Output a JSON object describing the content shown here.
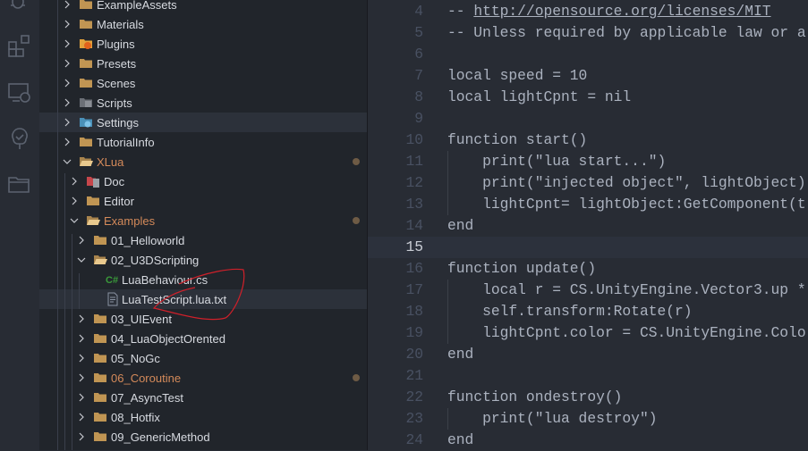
{
  "activity_bar": {
    "icons": [
      "debug-icon",
      "extensions-icon",
      "remote-explorer-icon",
      "source-control-tree-icon",
      "folder-icon"
    ]
  },
  "explorer": {
    "items": [
      {
        "label": "ExampleAssets",
        "depth": 0,
        "type": "folder",
        "expanded": false,
        "icon": "folder-icon"
      },
      {
        "label": "Materials",
        "depth": 0,
        "type": "folder",
        "expanded": false,
        "icon": "folder-icon"
      },
      {
        "label": "Plugins",
        "depth": 0,
        "type": "folder",
        "expanded": false,
        "icon": "plugins-folder-icon"
      },
      {
        "label": "Presets",
        "depth": 0,
        "type": "folder",
        "expanded": false,
        "icon": "folder-icon"
      },
      {
        "label": "Scenes",
        "depth": 0,
        "type": "folder",
        "expanded": false,
        "icon": "folder-icon"
      },
      {
        "label": "Scripts",
        "depth": 0,
        "type": "folder",
        "expanded": false,
        "icon": "scripts-folder-icon"
      },
      {
        "label": "Settings",
        "depth": 0,
        "type": "folder",
        "expanded": false,
        "icon": "settings-folder-icon",
        "hover": true
      },
      {
        "label": "TutorialInfo",
        "depth": 0,
        "type": "folder",
        "expanded": false,
        "icon": "folder-icon"
      },
      {
        "label": "XLua",
        "depth": 0,
        "type": "folder",
        "expanded": true,
        "icon": "folder-open-icon",
        "modified": true
      },
      {
        "label": "Doc",
        "depth": 1,
        "type": "folder",
        "expanded": false,
        "icon": "docs-folder-icon"
      },
      {
        "label": "Editor",
        "depth": 1,
        "type": "folder",
        "expanded": false,
        "icon": "folder-icon"
      },
      {
        "label": "Examples",
        "depth": 1,
        "type": "folder",
        "expanded": true,
        "icon": "folder-open-icon",
        "modified": true
      },
      {
        "label": "01_Helloworld",
        "depth": 2,
        "type": "folder",
        "expanded": false,
        "icon": "folder-icon"
      },
      {
        "label": "02_U3DScripting",
        "depth": 2,
        "type": "folder",
        "expanded": true,
        "icon": "folder-open-icon"
      },
      {
        "label": "LuaBehaviour.cs",
        "depth": 3,
        "type": "file",
        "icon": "csharp-file-icon"
      },
      {
        "label": "LuaTestScript.lua.txt",
        "depth": 3,
        "type": "file",
        "icon": "text-file-icon",
        "selected": true
      },
      {
        "label": "03_UIEvent",
        "depth": 2,
        "type": "folder",
        "expanded": false,
        "icon": "folder-icon"
      },
      {
        "label": "04_LuaObjectOrented",
        "depth": 2,
        "type": "folder",
        "expanded": false,
        "icon": "folder-icon"
      },
      {
        "label": "05_NoGc",
        "depth": 2,
        "type": "folder",
        "expanded": false,
        "icon": "folder-icon"
      },
      {
        "label": "06_Coroutine",
        "depth": 2,
        "type": "folder",
        "expanded": false,
        "icon": "folder-icon",
        "modified": true
      },
      {
        "label": "07_AsyncTest",
        "depth": 2,
        "type": "folder",
        "expanded": false,
        "icon": "folder-icon"
      },
      {
        "label": "08_Hotfix",
        "depth": 2,
        "type": "folder",
        "expanded": false,
        "icon": "folder-icon"
      },
      {
        "label": "09_GenericMethod",
        "depth": 2,
        "type": "folder",
        "expanded": false,
        "icon": "folder-icon"
      }
    ]
  },
  "editor": {
    "current_line": 15,
    "lines": [
      {
        "n": "4",
        "pre": "-- ",
        "url": "http://opensource.org/licenses/MIT",
        "text": ""
      },
      {
        "n": "5",
        "text": "-- Unless required by applicable law or a"
      },
      {
        "n": "6",
        "text": ""
      },
      {
        "n": "7",
        "text": "local speed = 10"
      },
      {
        "n": "8",
        "text": "local lightCpnt = nil"
      },
      {
        "n": "9",
        "text": ""
      },
      {
        "n": "10",
        "text": "function start()"
      },
      {
        "n": "11",
        "text": "    print(\"lua start...\")",
        "indent": true
      },
      {
        "n": "12",
        "text": "    print(\"injected object\", lightObject)",
        "indent": true
      },
      {
        "n": "13",
        "text": "    lightCpnt= lightObject:GetComponent(t",
        "indent": true
      },
      {
        "n": "14",
        "text": "end"
      },
      {
        "n": "15",
        "text": ""
      },
      {
        "n": "16",
        "text": "function update()"
      },
      {
        "n": "17",
        "text": "    local r = CS.UnityEngine.Vector3.up *",
        "indent": true
      },
      {
        "n": "18",
        "text": "    self.transform:Rotate(r)",
        "indent": true
      },
      {
        "n": "19",
        "text": "    lightCpnt.color = CS.UnityEngine.Colo",
        "indent": true
      },
      {
        "n": "20",
        "text": "end"
      },
      {
        "n": "21",
        "text": ""
      },
      {
        "n": "22",
        "text": "function ondestroy()"
      },
      {
        "n": "23",
        "text": "    print(\"lua destroy\")",
        "indent": true
      },
      {
        "n": "24",
        "text": "end"
      }
    ]
  },
  "colors": {
    "modified_folder": "#d48a5a",
    "folder": "#c09553",
    "annotation": "#d0202a"
  }
}
